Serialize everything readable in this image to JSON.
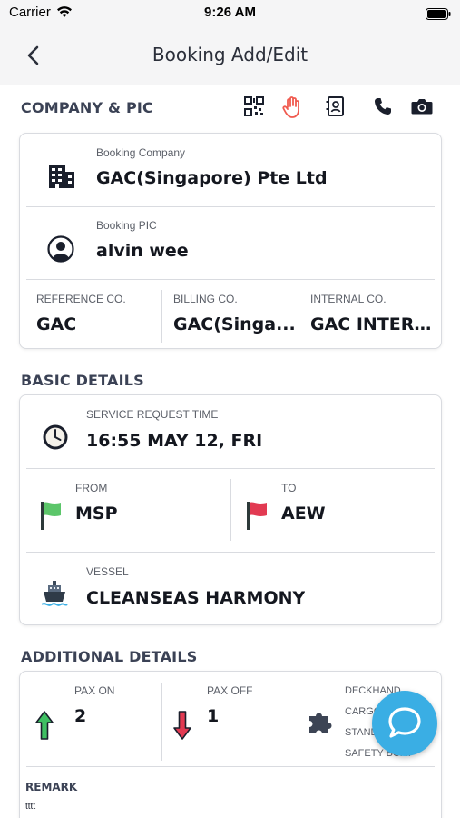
{
  "status_bar": {
    "carrier": "Carrier",
    "time": "9:26 AM"
  },
  "nav": {
    "title": "Booking Add/Edit"
  },
  "company_section": {
    "title": "COMPANY & PIC",
    "toolbar_icons": [
      "qr-code-icon",
      "hand-icon",
      "contact-card-icon",
      "phone-icon",
      "camera-icon"
    ],
    "booking_company_label": "Booking Company",
    "booking_company_value": "GAC(Singapore) Pte Ltd",
    "booking_pic_label": "Booking PIC",
    "booking_pic_value": "alvin wee",
    "reference_label": "REFERENCE CO.",
    "reference_value": "GAC",
    "billing_label": "BILLING CO.",
    "billing_value": "GAC(Singa...",
    "internal_label": "INTERNAL CO.",
    "internal_value": "GAC INTERN..."
  },
  "basic_section": {
    "title": "BASIC DETAILS",
    "service_time_label": "SERVICE REQUEST TIME",
    "service_time_value": "16:55 MAY 12, FRI",
    "from_label": "FROM",
    "from_value": "MSP",
    "to_label": "TO",
    "to_value": "AEW",
    "vessel_label": "VESSEL",
    "vessel_value": "CLEANSEAS HARMONY"
  },
  "additional_section": {
    "title": "ADDITIONAL DETAILS",
    "pax_on_label": "PAX ON",
    "pax_on_value": "2",
    "pax_off_label": "PAX OFF",
    "pax_off_value": "1",
    "extras": [
      "DECKHAND",
      "CARGO",
      "STANDBY",
      "SAFETY BOAT"
    ],
    "remark_label": "REMARK",
    "remark_value": "tttt"
  },
  "colors": {
    "accent_red": "#f05a4f",
    "fab_blue": "#3aaee4",
    "flag_green": "#5cc66a",
    "flag_red": "#e23a52"
  }
}
